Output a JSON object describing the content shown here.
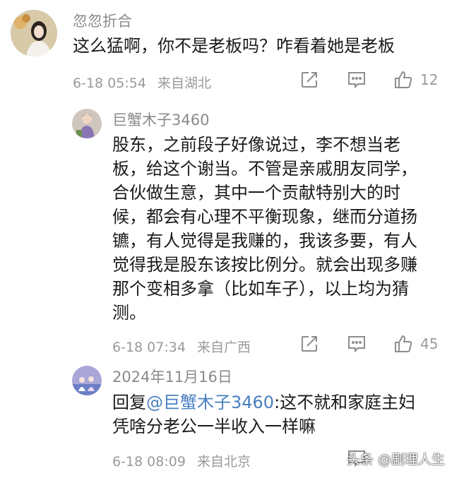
{
  "comments": [
    {
      "username": "忽忽折合",
      "text": "这么猛啊，你不是老板吗？咋看着她是老板",
      "date": "6-18 05:54",
      "location": "来自湖北",
      "likes": "12"
    },
    {
      "username": "巨蟹木子3460",
      "text": "股东，之前段子好像说过，李不想当老板，给这个谢当。不管是亲戚朋友同学，合伙做生意，其中一个贡献特别大的时候，都会有心理不平衡现象，继而分道扬镳，有人觉得是我赚的，我该多要，有人觉得我是股东该按比例分。就会出现多赚那个变相多拿（比如车子），以上均为猜测。",
      "date": "6-18 07:34",
      "location": "来自广西",
      "likes": "45"
    },
    {
      "username": "2024年11月16日",
      "reply_prefix": "回复",
      "mention": "@巨蟹木子3460",
      "reply_text": ":这不就和家庭主妇凭啥分老公一半收入一样嘛",
      "date": "6-18 08:09",
      "location": "来自北京"
    }
  ],
  "icons": {
    "share": "share-icon",
    "reply": "comment-reply-icon",
    "like": "thumbs-up-icon"
  },
  "watermark": "头条 @剧理人生",
  "colors": {
    "mention": "#4a7fbf",
    "meta": "#9a9a9a",
    "username": "#8a8a8a"
  }
}
